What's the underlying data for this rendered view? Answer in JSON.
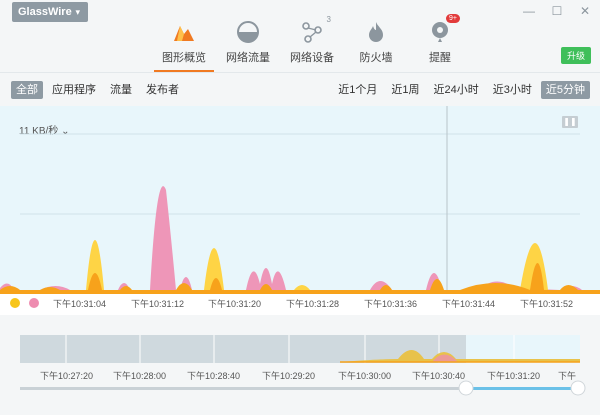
{
  "app": {
    "brand": "GlassWire"
  },
  "nav": {
    "tabs": [
      {
        "label": "图形概览",
        "icon": "graph-icon",
        "active": true
      },
      {
        "label": "网络流量",
        "icon": "usage-icon",
        "active": false
      },
      {
        "label": "网络设备",
        "icon": "network-icon",
        "active": false,
        "sup": "3"
      },
      {
        "label": "防火墙",
        "icon": "firewall-icon",
        "active": false
      },
      {
        "label": "提醒",
        "icon": "alert-icon",
        "active": false,
        "badge": "9+"
      }
    ],
    "upgrade_label": "升级"
  },
  "filters": {
    "left": [
      {
        "label": "全部",
        "active": true
      },
      {
        "label": "应用程序",
        "active": false
      },
      {
        "label": "流量",
        "active": false
      },
      {
        "label": "发布者",
        "active": false
      }
    ],
    "right": [
      {
        "label": "近1个月",
        "active": false
      },
      {
        "label": "近1周",
        "active": false
      },
      {
        "label": "近24小时",
        "active": false
      },
      {
        "label": "近3小时",
        "active": false
      },
      {
        "label": "近5分钟",
        "active": true
      }
    ]
  },
  "chart": {
    "rate_label": "11 KB/秒",
    "time_labels": [
      "下午10:31:04",
      "下午10:31:12",
      "下午10:31:20",
      "下午10:31:28",
      "下午10:31:36",
      "下午10:31:44",
      "下午10:31:52"
    ],
    "colors": {
      "incoming": "#f7a21b",
      "outgoing": "#ffd23b",
      "apps": "#ee8cb0",
      "bg": "#e8f6fb"
    }
  },
  "timeline": {
    "labels": [
      "下午10:27:20",
      "下午10:28:00",
      "下午10:28:40",
      "下午10:29:20",
      "下午10:30:00",
      "下午10:30:40",
      "下午10:31:20",
      "下午"
    ]
  },
  "chart_data": {
    "type": "area",
    "x": [
      "下午10:31:04",
      "下午10:31:12",
      "下午10:31:20",
      "下午10:31:28",
      "下午10:31:36",
      "下午10:31:44",
      "下午10:31:52"
    ],
    "ylabel": "",
    "series": []
  }
}
